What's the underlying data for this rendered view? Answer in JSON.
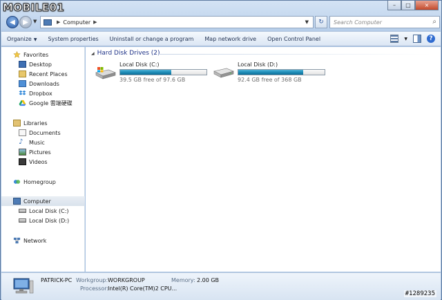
{
  "watermark": {
    "logo": "MOBILE01",
    "image_number": "#1289235"
  },
  "window": {
    "caption": {
      "minimize": "–",
      "maximize": "□",
      "close": "×"
    }
  },
  "nav": {
    "breadcrumb": {
      "root_arrow": "▶",
      "item": "Computer",
      "trail_arrow": "▶"
    },
    "search_placeholder": "Search Computer"
  },
  "toolbar": {
    "items": [
      "Organize",
      "System properties",
      "Uninstall or change a program",
      "Map network drive",
      "Open Control Panel"
    ],
    "organize_arrow": "▼",
    "icons": [
      "views-icon",
      "preview-pane-icon",
      "help-icon"
    ]
  },
  "sidebar": {
    "favorites_header": "Favorites",
    "favorites": [
      "Desktop",
      "Recent Places",
      "Downloads",
      "Dropbox",
      "Google 雲端硬碟"
    ],
    "libraries_header": "Libraries",
    "libraries": [
      "Documents",
      "Music",
      "Pictures",
      "Videos"
    ],
    "homegroup": "Homegroup",
    "computer_header": "Computer",
    "computer": [
      "Local Disk (C:)",
      "Local Disk (D:)"
    ],
    "network": "Network"
  },
  "content": {
    "group_title": "Hard Disk Drives (2)",
    "drives": [
      {
        "name": "Local Disk (C:)",
        "free_text": "39.5 GB free of 97.6 GB",
        "used_fraction": 0.595,
        "icon": "system-drive-icon"
      },
      {
        "name": "Local Disk (D:)",
        "free_text": "92.4 GB free of 368 GB",
        "used_fraction": 0.749,
        "icon": "hard-drive-icon"
      }
    ],
    "bar_color": "#1f8db8"
  },
  "details": {
    "computer_name": "PATRICK-PC",
    "workgroup_label": "Workgroup:",
    "workgroup_value": "WORKGROUP",
    "memory_label": "Memory:",
    "memory_value": "2.00 GB",
    "processor_label": "Processor:",
    "processor_value": "Intel(R) Core(TM)2 CPU..."
  }
}
